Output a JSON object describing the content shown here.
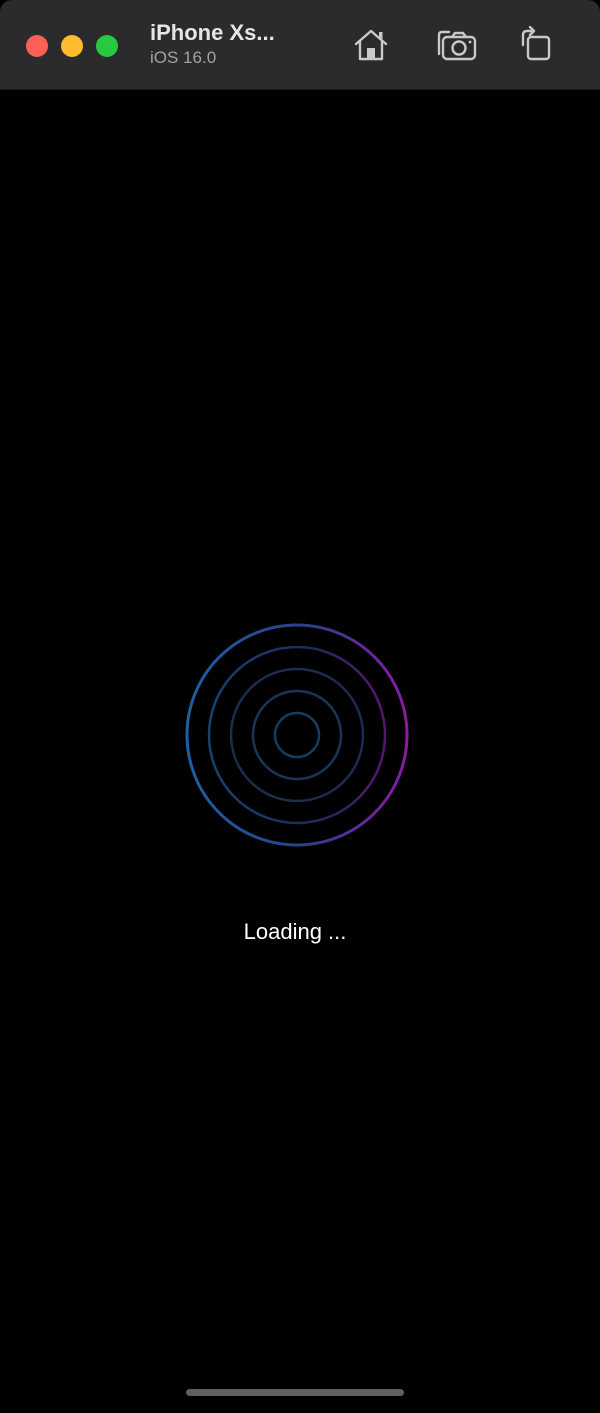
{
  "window": {
    "device_name": "iPhone Xs...",
    "os_version": "iOS 16.0"
  },
  "toolbar": {
    "home_icon": "home-icon",
    "screenshot_icon": "camera-icon",
    "rotate_icon": "rotate-icon"
  },
  "screen": {
    "loading_text": "Loading ..."
  },
  "colors": {
    "traffic_close": "#fe5f57",
    "traffic_minimize": "#febc2e",
    "traffic_zoom": "#28c840",
    "spinner_left": "#1d5fa0",
    "spinner_right": "#8a1aa0",
    "background": "#000000"
  }
}
